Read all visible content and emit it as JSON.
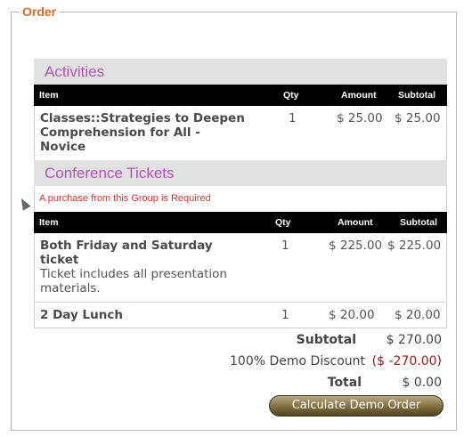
{
  "legend": "Order",
  "sections": [
    {
      "title": "Activities",
      "headers": {
        "item": "Item",
        "qty": "Qty",
        "amount": "Amount",
        "subtotal": "Subtotal"
      },
      "rows": [
        {
          "name_lines": [
            "Classes::Strategies to Deepen",
            "Comprehension for All -",
            "Novice"
          ],
          "qty": "1",
          "amount": "$ 25.00",
          "subtotal": "$ 25.00"
        }
      ]
    },
    {
      "title": "Conference Tickets",
      "note": "A purchase from this Group is Required",
      "headers": {
        "item": "Item",
        "qty": "Qty",
        "amount": "Amount",
        "subtotal": "Subtotal"
      },
      "rows": [
        {
          "name_lines": [
            "Both Friday and Saturday",
            "ticket"
          ],
          "desc_lines": [
            "Ticket includes all presentation",
            "materials."
          ],
          "qty": "1",
          "amount": "$ 225.00",
          "subtotal": "$ 225.00"
        },
        {
          "name_lines": [
            "2 Day Lunch"
          ],
          "qty": "1",
          "amount": "$ 20.00",
          "subtotal": "$ 20.00"
        }
      ]
    }
  ],
  "summary": {
    "subtotal_label": "Subtotal",
    "subtotal_value": "$ 270.00",
    "discount_label": "100% Demo Discount",
    "discount_value": "($ -270.00)",
    "total_label": "Total",
    "total_value": "$ 0.00"
  },
  "button_label": "Calculate Demo Order",
  "colors": {
    "legend": "#e06a2a",
    "section_title": "#b455b4",
    "required": "#e03030",
    "discount": "#a01818"
  }
}
